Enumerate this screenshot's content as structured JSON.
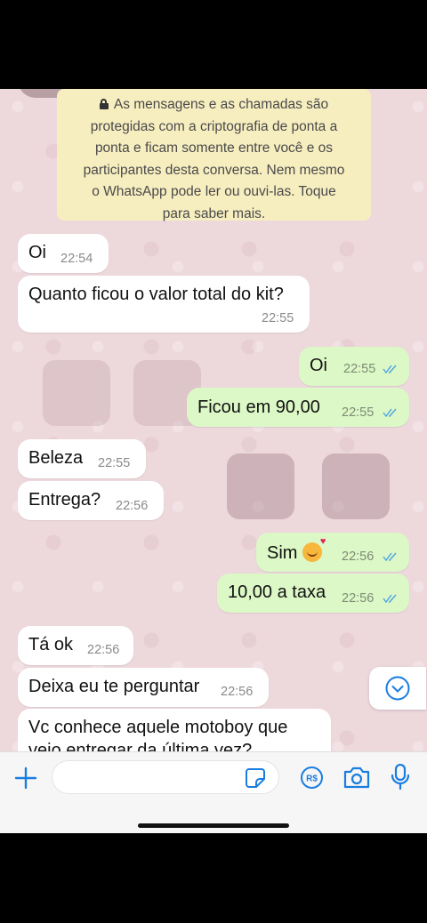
{
  "encryption_notice": {
    "lines": [
      "As mensagens e as chamadas são",
      "protegidas com a criptografia de ponta a",
      "ponta e ficam somente entre você e os",
      "participantes desta conversa. Nem mesmo",
      "o WhatsApp pode ler ou ouvi-las. Toque",
      "para saber mais."
    ]
  },
  "messages": [
    {
      "direction": "in",
      "text": "Oi",
      "time": "22:54"
    },
    {
      "direction": "in",
      "text": "Quanto ficou o valor total do kit?",
      "time": "22:55"
    },
    {
      "direction": "out",
      "text": "Oi",
      "time": "22:55",
      "read": true
    },
    {
      "direction": "out",
      "text": "Ficou em 90,00",
      "time": "22:55",
      "read": true
    },
    {
      "direction": "in",
      "text": "Beleza",
      "time": "22:55"
    },
    {
      "direction": "in",
      "text": "Entrega?",
      "time": "22:56"
    },
    {
      "direction": "out",
      "text": "Sim",
      "emoji": "smiling-face-with-hearts",
      "time": "22:56",
      "read": true
    },
    {
      "direction": "out",
      "text": "10,00 a taxa",
      "time": "22:56",
      "read": true
    },
    {
      "direction": "in",
      "text": "Tá ok",
      "time": "22:56"
    },
    {
      "direction": "in",
      "text": "Deixa eu te perguntar",
      "time": "22:56"
    },
    {
      "direction": "in",
      "text": "Vc conhece aquele motoboy que",
      "text_line2": "veio entregar da última vez?"
    }
  ],
  "input": {
    "placeholder": "",
    "value": ""
  },
  "colors": {
    "accent": "#1a7de0",
    "incoming": "#ffffff",
    "outgoing": "#dcf8c6",
    "notice": "#f7eec0",
    "read_ticks": "#4fa3e3"
  }
}
